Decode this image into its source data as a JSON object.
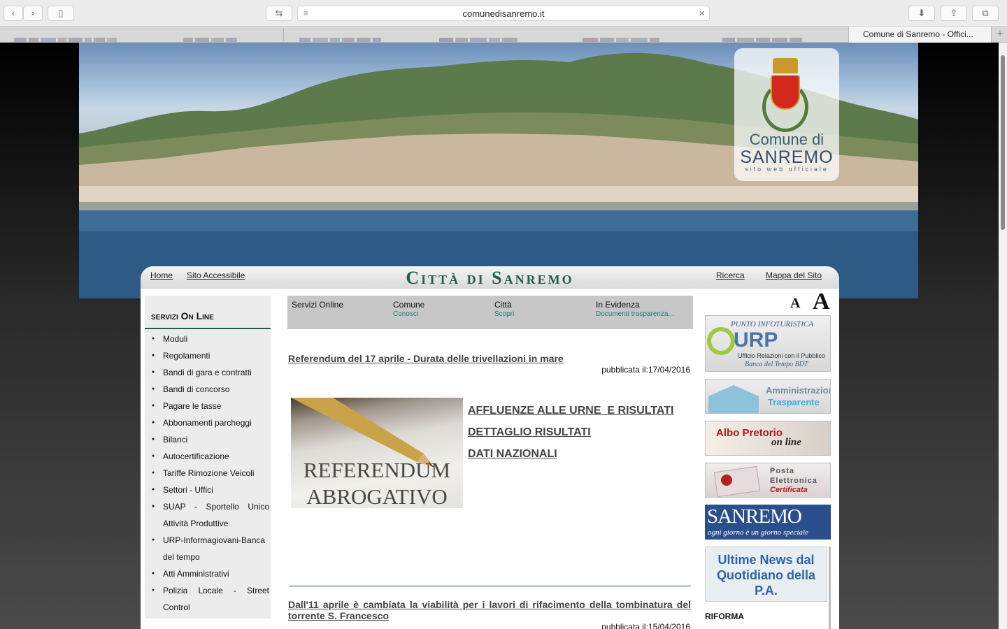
{
  "browser": {
    "url": "comunedisanremo.it",
    "active_tab_title": "Comune di Sanremo - Offici..."
  },
  "banner": {
    "logo": {
      "line1": "Comune di",
      "line2": "SANREMO",
      "line3": "sito web ufficiale"
    },
    "site_title": "Città di Sanremo",
    "nav_left": [
      "Home",
      "Sito Accessibile"
    ],
    "nav_right": [
      "Ricerca",
      "Mappa del Sito"
    ]
  },
  "sidebar": {
    "title": "servizi On Line",
    "items": [
      "Moduli",
      "Regolamenti",
      "Bandi di gara e contratti",
      "Bandi di concorso",
      "Pagare le tasse",
      "Abbonamenti parcheggi",
      "Bilanci",
      "Autocertificazione",
      "Tariffe Rimozione Veicoli",
      "Settori - Uffici",
      "SUAP - Sportello Unico Attività Produttive",
      "URP-Informagiovani-Banca del tempo",
      "Atti Amministrativi",
      "Polizia Locale - Street Control"
    ]
  },
  "tabs": [
    {
      "title": "Servizi Online",
      "sub": ""
    },
    {
      "title": "Comune",
      "sub": "Conosci"
    },
    {
      "title": "Città",
      "sub": "Scopri"
    },
    {
      "title": "In Evidenza",
      "sub": "Documenti trasparenza..."
    }
  ],
  "articles": {
    "first": {
      "title": "Referendum del 17 aprile - Durata delle trivellazioni in mare",
      "published": "pubblicata il:17/04/2016",
      "image_text_1": "REFERENDUM",
      "image_text_2": "ABROGATIVO",
      "links": [
        "AFFLUENZE ALLE URNE  E RISULTATI",
        "DETTAGLIO RISULTATI",
        "DATI NAZIONALI"
      ]
    },
    "second": {
      "title": "Dall'11 aprile è cambiata la viabilità per i lavori di rifacimento della tombinatura del torrente S. Francesco",
      "published": "pubblicata il:15/04/2016"
    }
  },
  "right_column": {
    "font_small": "A",
    "font_large": "A",
    "urp": {
      "line1": "PUNTO INFOTURISTICA",
      "line2": "URP",
      "line3": "Ufficio Relazioni con il Pubblico",
      "line4": "Banca del Tempo BDT"
    },
    "trasparente": {
      "line1": "Amministrazione",
      "line2": "Trasparente"
    },
    "albo": {
      "line1": "Albo Pretorio",
      "line2": "on line"
    },
    "pec": {
      "line1": "Posta",
      "line2": "Elettronica",
      "line3": "Certificata"
    },
    "sanremo": {
      "line1": "SANREMO",
      "line2": "ogni giorno è un giorno speciale"
    },
    "news": "Ultime News dal Quotidiano della P.A.",
    "riforma": "RIFORMA"
  },
  "colors": {
    "accent_teal": "#1f5c52",
    "link_teal": "#1c7a74",
    "news_blue": "#2f63a6"
  }
}
